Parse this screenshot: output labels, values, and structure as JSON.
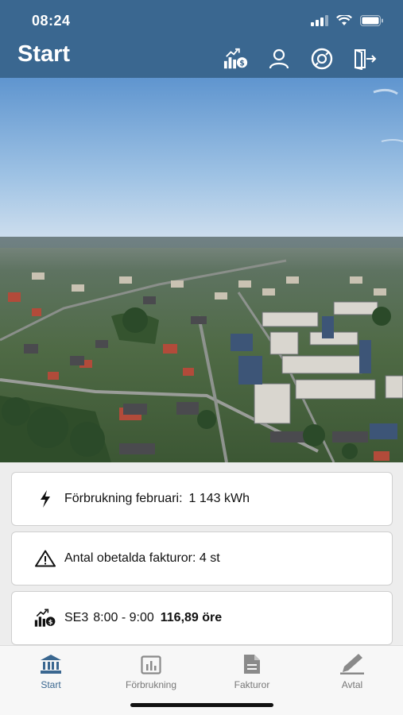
{
  "status_bar": {
    "time": "08:24"
  },
  "header": {
    "title": "Start"
  },
  "hero": {
    "icon": "aerial-town-photo"
  },
  "cards": {
    "consumption": {
      "label": "Förbrukning februari:",
      "value": "1 143 kWh"
    },
    "unpaid": {
      "text": "Antal obetalda fakturor: 4 st"
    },
    "price": {
      "zone": "SE3",
      "hours": "8:00 - 9:00",
      "value": "116,89 öre"
    }
  },
  "tabs": {
    "start": "Start",
    "consumption": "Förbrukning",
    "invoices": "Fakturor",
    "agreement": "Avtal"
  },
  "colors": {
    "primary": "#3a6790",
    "background": "#ededed"
  }
}
